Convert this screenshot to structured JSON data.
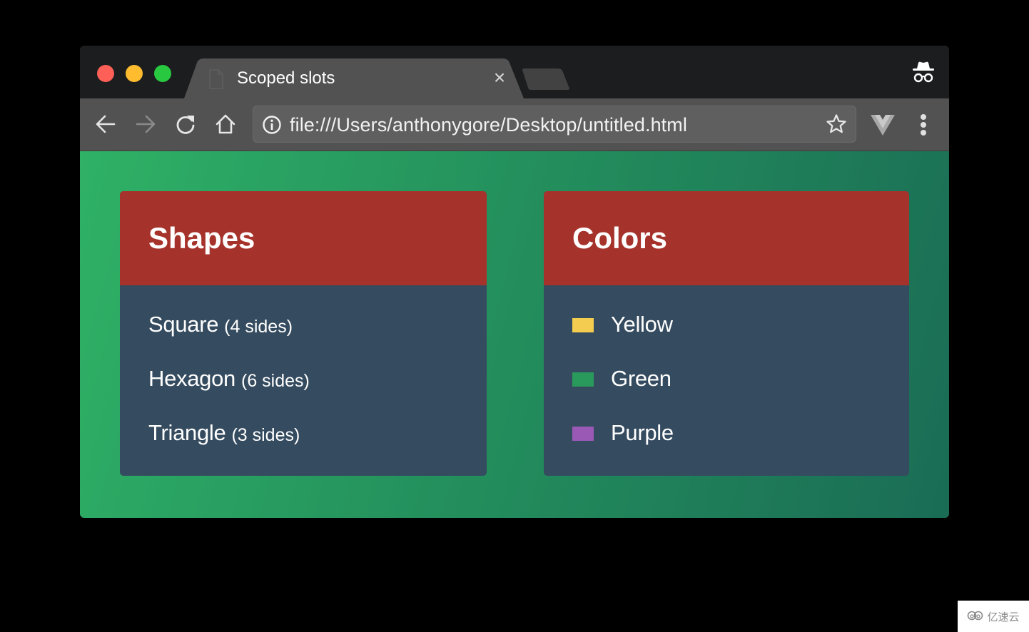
{
  "browser": {
    "tab": {
      "title": "Scoped slots",
      "close_glyph": "×",
      "icon": "file-icon"
    },
    "toolbar": {
      "back_icon": "arrow-left-icon",
      "forward_icon": "arrow-right-icon",
      "reload_icon": "reload-icon",
      "home_icon": "home-icon",
      "url": "file:///Users/anthonygore/Desktop/untitled.html",
      "info_icon": "info-icon",
      "bookmark_icon": "star-icon",
      "extension_icon": "vue-devtools-icon",
      "menu_icon": "more-vertical-icon"
    },
    "incognito_icon": "incognito-icon"
  },
  "page": {
    "background_gradient": [
      "#2fb166",
      "#1a6c55"
    ],
    "cards": [
      {
        "title": "Shapes",
        "items": [
          {
            "name": "Square",
            "detail": "(4 sides)"
          },
          {
            "name": "Hexagon",
            "detail": "(6 sides)"
          },
          {
            "name": "Triangle",
            "detail": "(3 sides)"
          }
        ]
      },
      {
        "title": "Colors",
        "items": [
          {
            "name": "Yellow",
            "swatch": "#f4cd50"
          },
          {
            "name": "Green",
            "swatch": "#2a9a5c"
          },
          {
            "name": "Purple",
            "swatch": "#9b59b6"
          }
        ]
      }
    ],
    "colors": {
      "card_header": "#a6332b",
      "card_body": "#354b5f"
    }
  },
  "watermark": {
    "text": "亿速云"
  }
}
